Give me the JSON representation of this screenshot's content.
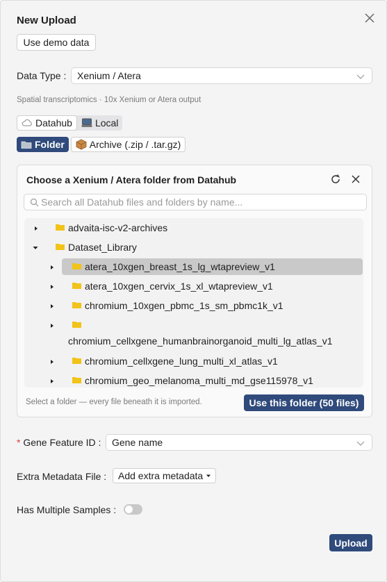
{
  "dialog": {
    "title": "New Upload",
    "demo_button": "Use demo data"
  },
  "data_type": {
    "label": "Data Type",
    "value": "Xenium / Atera",
    "hint": "Spatial transcriptomics · 10x Xenium or Atera output"
  },
  "source_tabs": [
    {
      "label": "Datahub",
      "icon": "cloud-icon",
      "active": true
    },
    {
      "label": "Local",
      "icon": "computer-icon",
      "active": false
    }
  ],
  "format_tabs": [
    {
      "label": "Folder",
      "icon": "folder-icon",
      "selected": true
    },
    {
      "label": "Archive (.zip / .tar.gz)",
      "icon": "package-icon",
      "selected": false
    }
  ],
  "picker": {
    "title": "Choose a Xenium / Atera folder from Datahub",
    "search_placeholder": "Search all Datahub files and folders by name...",
    "footer_hint": "Select a folder — every file beneath it is imported.",
    "confirm_button": "Use this folder (50 files)",
    "tree": [
      {
        "name": "advaita-isc-v2-archives",
        "level": 0,
        "expanded": false
      },
      {
        "name": "Dataset_Library",
        "level": 0,
        "expanded": true
      },
      {
        "name": "atera_10xgen_breast_1s_lg_wtapreview_v1",
        "level": 1,
        "expanded": false,
        "selected": true
      },
      {
        "name": "atera_10xgen_cervix_1s_xl_wtapreview_v1",
        "level": 1,
        "expanded": false
      },
      {
        "name": "chromium_10xgen_pbmc_1s_sm_pbmc1k_v1",
        "level": 1,
        "expanded": false
      },
      {
        "name": "chromium_cellxgene_humanbrainorganoid_multi_lg_atlas_v1",
        "level": 1,
        "expanded": false
      },
      {
        "name": "chromium_cellxgene_lung_multi_xl_atlas_v1",
        "level": 1,
        "expanded": false
      },
      {
        "name": "chromium_geo_melanoma_multi_md_gse115978_v1",
        "level": 1,
        "expanded": false
      }
    ]
  },
  "gene_feature": {
    "label": "Gene Feature ID",
    "required_mark": "*",
    "value": "Gene name"
  },
  "extra_metadata": {
    "label": "Extra Metadata File",
    "button": "Add extra metadata"
  },
  "multiple_samples": {
    "label": "Has Multiple Samples",
    "on": false
  },
  "upload_button": "Upload",
  "colors": {
    "primary": "#2f4a7b",
    "folder": "#f2c318",
    "selected_row": "#c9c9ca",
    "required": "#e03c3c"
  }
}
